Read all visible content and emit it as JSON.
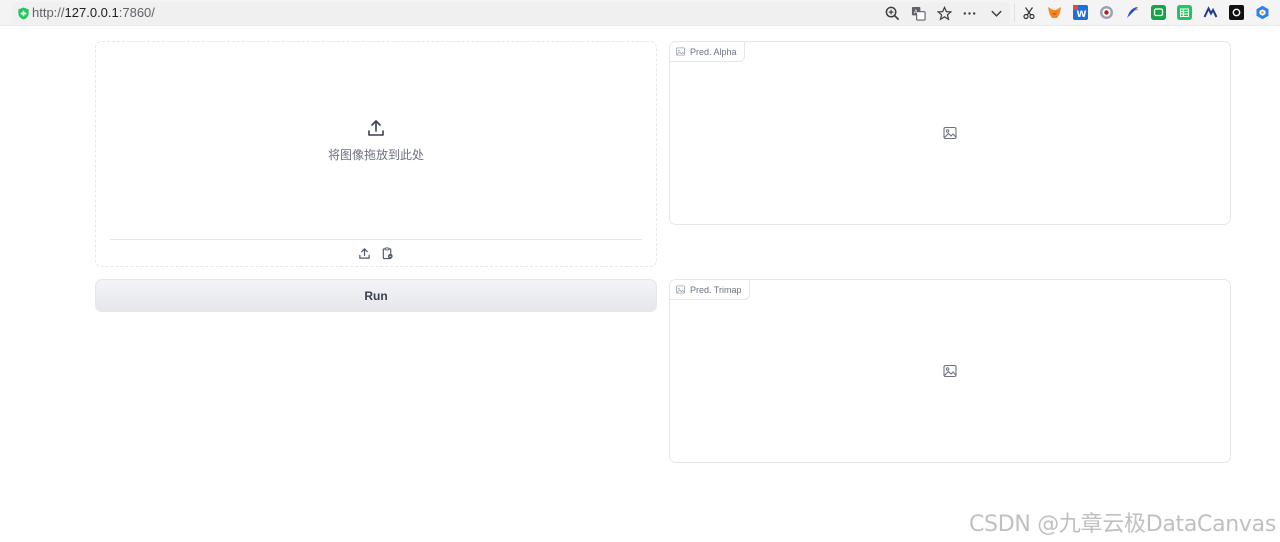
{
  "browser": {
    "url_scheme": "http://",
    "url_host": "127.0.0.1",
    "url_rest": ":7860/",
    "toolbar_icons": [
      "zoom-icon",
      "translate-icon",
      "bookmark-star-icon",
      "more-icon",
      "chevron-down-icon"
    ],
    "extensions": [
      {
        "name": "scissors-extension-icon",
        "color": "#ffffff",
        "glyph": "✂"
      },
      {
        "name": "fox-extension-icon",
        "color": "#f6851b",
        "glyph": "◆"
      },
      {
        "name": "w-extension-icon",
        "color": "#2b6cb0",
        "glyph": "W"
      },
      {
        "name": "eye-extension-icon",
        "color": "#6b7280",
        "glyph": "◉"
      },
      {
        "name": "feather-extension-icon",
        "color": "#1d4ed8",
        "glyph": "✦"
      },
      {
        "name": "chat-extension-icon",
        "color": "#16a34a",
        "glyph": "▢"
      },
      {
        "name": "sheet-extension-icon",
        "color": "#22c55e",
        "glyph": "▦"
      },
      {
        "name": "m-extension-icon",
        "color": "#ffffff",
        "glyph": "Λ"
      },
      {
        "name": "dark-extension-icon",
        "color": "#111111",
        "glyph": "◎"
      },
      {
        "name": "cube-extension-icon",
        "color": "#3b82f6",
        "glyph": "⬡"
      }
    ]
  },
  "upload": {
    "drop_text": "将图像拖放到此处",
    "icon": "upload-icon",
    "toolbar": [
      "upload-icon",
      "clipboard-icon"
    ]
  },
  "run_button": {
    "label": "Run"
  },
  "outputs": {
    "alpha": {
      "label": "Pred. Alpha",
      "icon": "image-icon"
    },
    "trimap": {
      "label": "Pred. Trimap",
      "icon": "image-icon"
    }
  },
  "watermark": "CSDN @九章云极DataCanvas"
}
